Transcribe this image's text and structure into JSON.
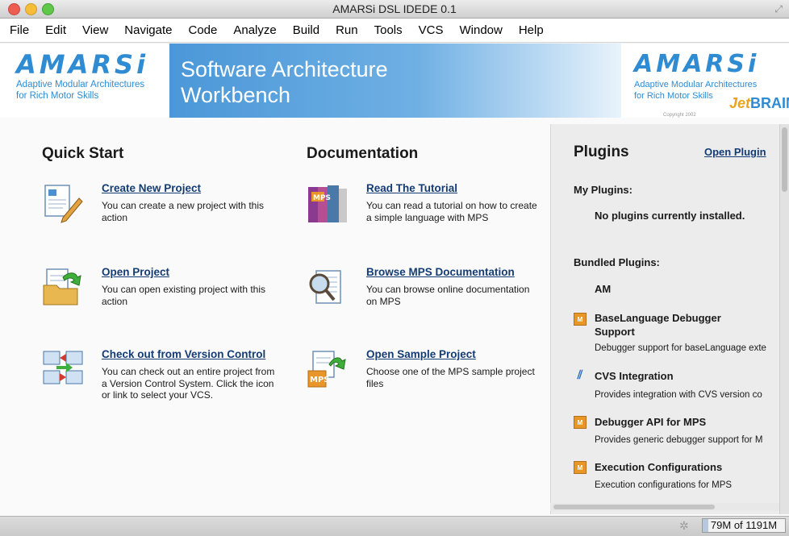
{
  "window": {
    "title": "AMARSi DSL IDEDE 0.1"
  },
  "menu": [
    "File",
    "Edit",
    "View",
    "Navigate",
    "Code",
    "Analyze",
    "Build",
    "Run",
    "Tools",
    "VCS",
    "Window",
    "Help"
  ],
  "banner": {
    "logo_word": "AMARSi",
    "logo_tagline_line1": "Adaptive Modular Architectures",
    "logo_tagline_line2": "for Rich Motor Skills",
    "title": "Software Architecture Workbench",
    "jetbrains_logo": "JetBRAINS",
    "copyright": "Copyright 2002",
    "colors": {
      "accent": "#2f8bd2",
      "banner_blue": "#4b97d8"
    }
  },
  "quick_start": {
    "title": "Quick Start",
    "actions": [
      {
        "label": "Create New Project",
        "desc": "You can create a new project with this action",
        "icon": "new-project-icon"
      },
      {
        "label": "Open Project",
        "desc": "You can open existing project with this action",
        "icon": "open-folder-icon"
      },
      {
        "label": "Check out from Version Control",
        "desc": "You can check out an entire project from a Version Control System. Click the icon or link to select your VCS.",
        "icon": "vcs-checkout-icon"
      }
    ]
  },
  "documentation": {
    "title": "Documentation",
    "actions": [
      {
        "label": "Read The Tutorial",
        "desc": "You can read a tutorial on how to create a simple language with MPS",
        "icon": "tutorial-book-icon"
      },
      {
        "label": "Browse MPS Documentation",
        "desc": "You can browse online documentation on MPS",
        "icon": "browse-docs-icon"
      },
      {
        "label": "Open Sample Project",
        "desc": "Choose one of the MPS sample project files",
        "icon": "sample-project-icon"
      }
    ]
  },
  "plugins": {
    "title": "Plugins",
    "open_link": "Open Plugin",
    "my_plugins_header": "My Plugins:",
    "my_plugins_empty": "No plugins currently installed.",
    "bundled_header": "Bundled Plugins:",
    "bundled": [
      {
        "name": "AM",
        "desc": "",
        "icon": ""
      },
      {
        "name": "BaseLanguage Debugger Support",
        "desc": "Debugger support for baseLanguage exte",
        "icon": "mps-plugin-icon"
      },
      {
        "name": "CVS Integration",
        "desc": "Provides integration with CVS version co",
        "icon": "cvs-plugin-icon"
      },
      {
        "name": "Debugger API for MPS",
        "desc": "Provides generic debugger support for M",
        "icon": "mps-plugin-icon"
      },
      {
        "name": "Execution Configurations",
        "desc": "Execution configurations for MPS",
        "icon": "mps-plugin-icon"
      }
    ]
  },
  "status": {
    "memory": "79M of 1191M",
    "memory_used_fraction": 0.066
  }
}
